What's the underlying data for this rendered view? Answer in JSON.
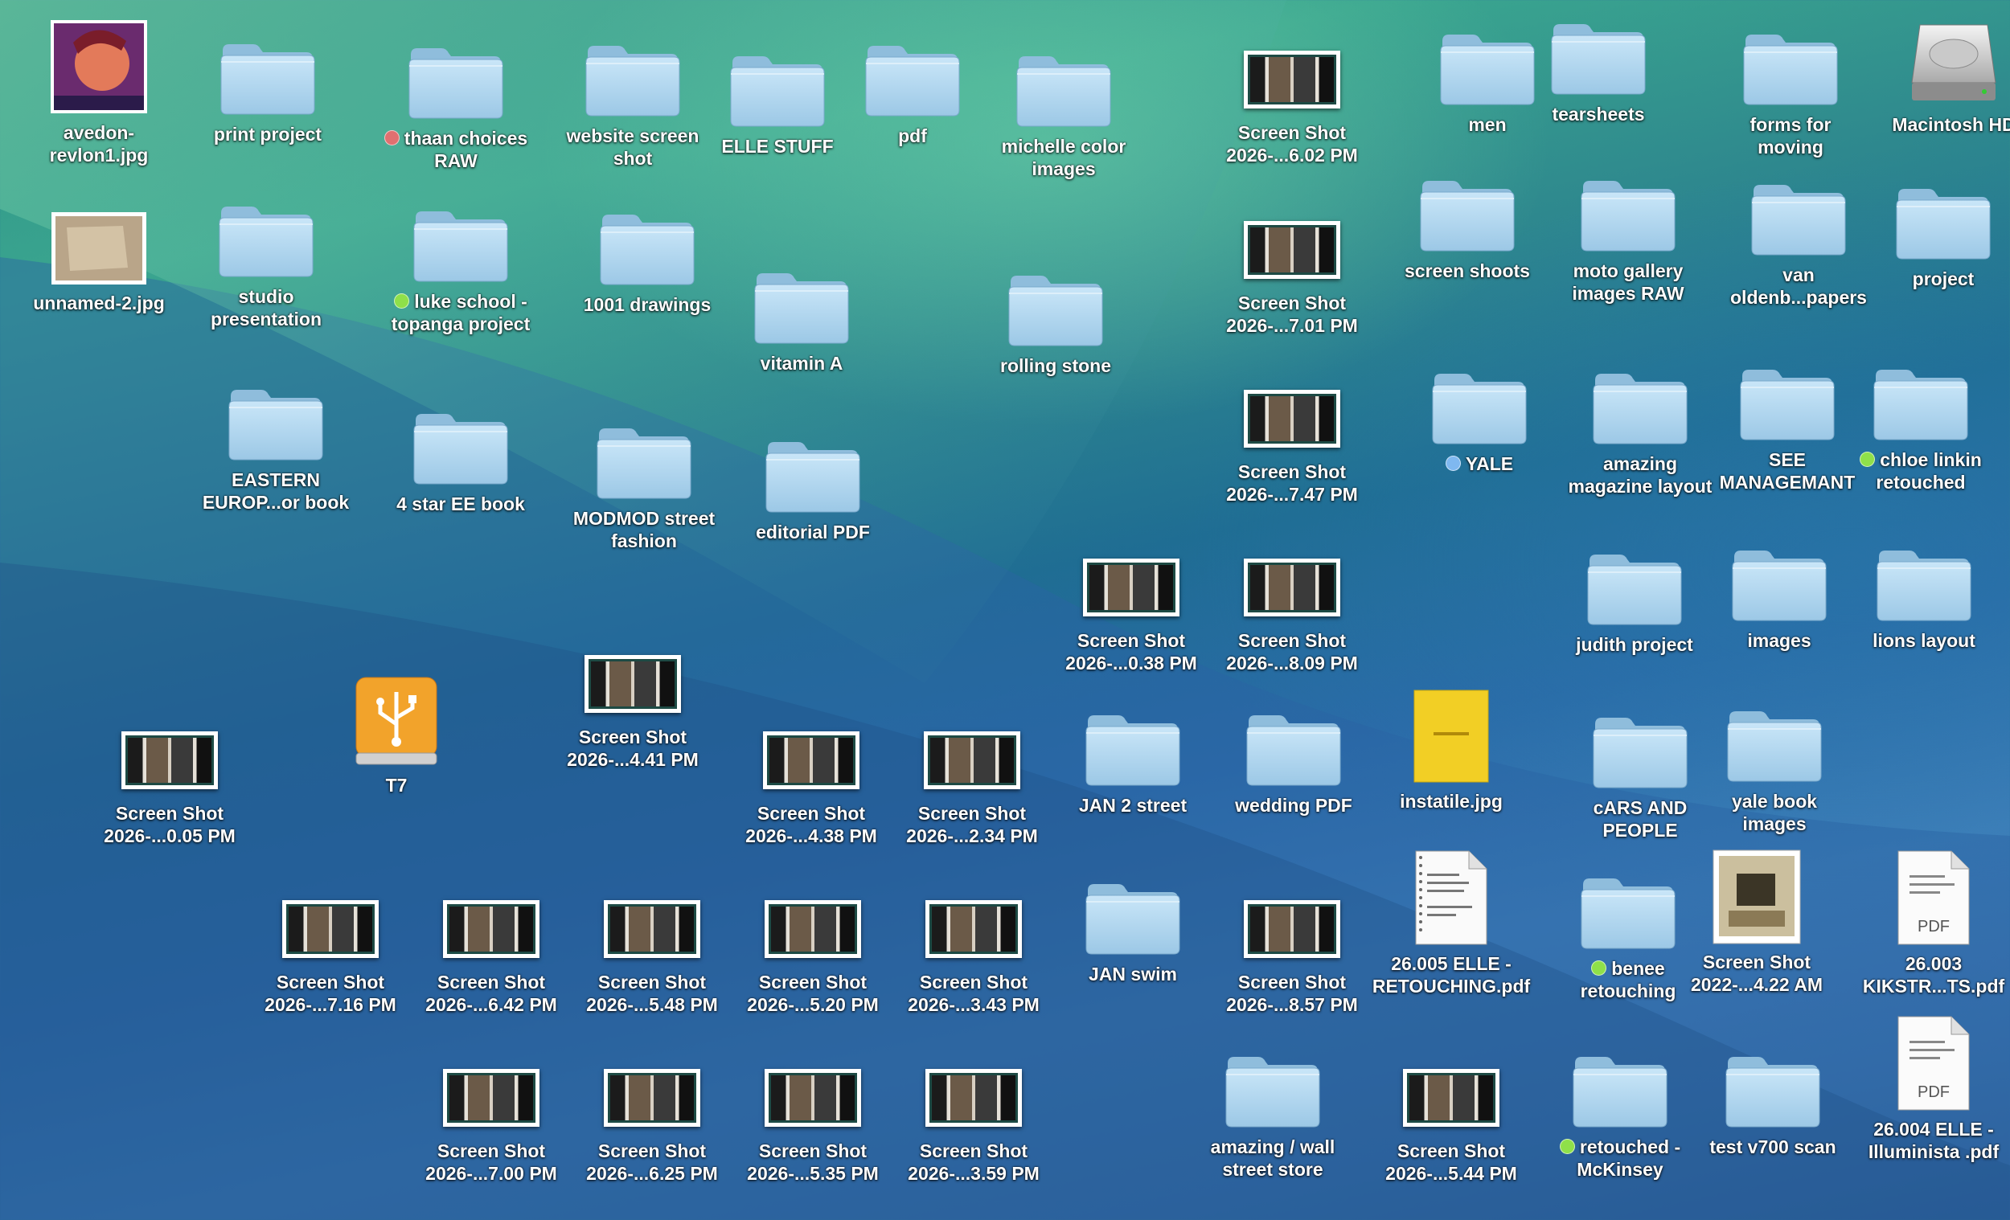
{
  "desktop": {
    "items": [
      {
        "label": "avedon-\nrevlon1.jpg",
        "type": "image-portrait",
        "x": 0,
        "y": 0
      },
      {
        "label": "print project",
        "type": "folder"
      },
      {
        "label": "thaan choices\nRAW",
        "type": "folder",
        "tag": "#e07070"
      },
      {
        "label": "website screen\nshot",
        "type": "folder"
      },
      {
        "label": "ELLE STUFF",
        "type": "folder"
      },
      {
        "label": "pdf",
        "type": "folder"
      },
      {
        "label": "michelle color\nimages",
        "type": "folder"
      },
      {
        "label": "Screen Shot\n2026-...6.02 PM",
        "type": "screenshot"
      },
      {
        "label": "men",
        "type": "folder"
      },
      {
        "label": "tearsheets",
        "type": "folder"
      },
      {
        "label": "forms for\nmoving",
        "type": "folder"
      },
      {
        "label": "Macintosh HD",
        "type": "hard-drive"
      },
      {
        "label": "unnamed-2.jpg",
        "type": "image-paper"
      },
      {
        "label": "studio\npresentation",
        "type": "folder"
      },
      {
        "label": "luke school -\ntopanga project",
        "type": "folder",
        "tag": "#8fe04a"
      },
      {
        "label": "1001 drawings",
        "type": "folder"
      },
      {
        "label": "vitamin A",
        "type": "folder"
      },
      {
        "label": "rolling stone",
        "type": "folder"
      },
      {
        "label": "Screen Shot\n2026-...7.01 PM",
        "type": "screenshot"
      },
      {
        "label": "screen shoots",
        "type": "folder"
      },
      {
        "label": "moto gallery\nimages RAW",
        "type": "folder"
      },
      {
        "label": "van\noldenb...papers",
        "type": "folder"
      },
      {
        "label": "project",
        "type": "folder"
      },
      {
        "label": "EASTERN\nEUROP...or book",
        "type": "folder"
      },
      {
        "label": "4 star EE book",
        "type": "folder"
      },
      {
        "label": "MODMOD street\nfashion",
        "type": "folder"
      },
      {
        "label": "editorial PDF",
        "type": "folder"
      },
      {
        "label": "Screen Shot\n2026-...7.47 PM",
        "type": "screenshot"
      },
      {
        "label": "YALE",
        "type": "folder",
        "tag": "#7fb8f0"
      },
      {
        "label": "amazing\nmagazine layout",
        "type": "folder"
      },
      {
        "label": "SEE\nMANAGEMANT",
        "type": "folder"
      },
      {
        "label": "chloe linkin\nretouched",
        "type": "folder",
        "tag": "#8fe04a"
      },
      {
        "label": "Screen Shot\n2026-...0.38 PM",
        "type": "screenshot"
      },
      {
        "label": "Screen Shot\n2026-...8.09 PM",
        "type": "screenshot"
      },
      {
        "label": "judith project",
        "type": "folder"
      },
      {
        "label": "images",
        "type": "folder"
      },
      {
        "label": "lions layout",
        "type": "folder"
      },
      {
        "label": "Screen Shot\n2026-...4.41 PM",
        "type": "screenshot"
      },
      {
        "label": "T7",
        "type": "usb-drive"
      },
      {
        "label": "Screen Shot\n2026-...0.05 PM",
        "type": "screenshot"
      },
      {
        "label": "Screen Shot\n2026-...4.38 PM",
        "type": "screenshot"
      },
      {
        "label": "Screen Shot\n2026-...2.34 PM",
        "type": "screenshot"
      },
      {
        "label": "JAN 2 street",
        "type": "folder"
      },
      {
        "label": "wedding PDF",
        "type": "folder"
      },
      {
        "label": "instatile.jpg",
        "type": "image-yellow"
      },
      {
        "label": "cARS AND\nPEOPLE",
        "type": "folder"
      },
      {
        "label": "yale book\nimages",
        "type": "folder"
      },
      {
        "label": "Screen Shot\n2026-...7.16 PM",
        "type": "screenshot"
      },
      {
        "label": "Screen Shot\n2026-...6.42 PM",
        "type": "screenshot"
      },
      {
        "label": "Screen Shot\n2026-...5.48 PM",
        "type": "screenshot"
      },
      {
        "label": "Screen Shot\n2026-...5.20 PM",
        "type": "screenshot"
      },
      {
        "label": "Screen Shot\n2026-...3.43 PM",
        "type": "screenshot"
      },
      {
        "label": "JAN swim",
        "type": "folder"
      },
      {
        "label": "Screen Shot\n2026-...8.57 PM",
        "type": "screenshot"
      },
      {
        "label": "26.005 ELLE -\nRETOUCHING.pdf",
        "type": "doc"
      },
      {
        "label": "benee\nretouching",
        "type": "folder",
        "tag": "#8fe04a"
      },
      {
        "label": "Screen Shot\n2022-...4.22 AM",
        "type": "screenshot-tall"
      },
      {
        "label": "26.003\nKIKSTR...TS.pdf",
        "type": "pdf",
        "badge": "PDF"
      },
      {
        "label": "Screen Shot\n2026-...7.00 PM",
        "type": "screenshot"
      },
      {
        "label": "Screen Shot\n2026-...6.25 PM",
        "type": "screenshot"
      },
      {
        "label": "Screen Shot\n2026-...5.35 PM",
        "type": "screenshot"
      },
      {
        "label": "Screen Shot\n2026-...3.59 PM",
        "type": "screenshot"
      },
      {
        "label": "amazing / wall\nstreet store",
        "type": "folder"
      },
      {
        "label": "Screen Shot\n2026-...5.44 PM",
        "type": "screenshot"
      },
      {
        "label": "retouched -\nMcKinsey",
        "type": "folder",
        "tag": "#8fe04a"
      },
      {
        "label": "test v700 scan",
        "type": "folder"
      },
      {
        "label": "26.004 ELLE -\nIlluminista .pdf",
        "type": "pdf",
        "badge": "PDF"
      }
    ]
  }
}
